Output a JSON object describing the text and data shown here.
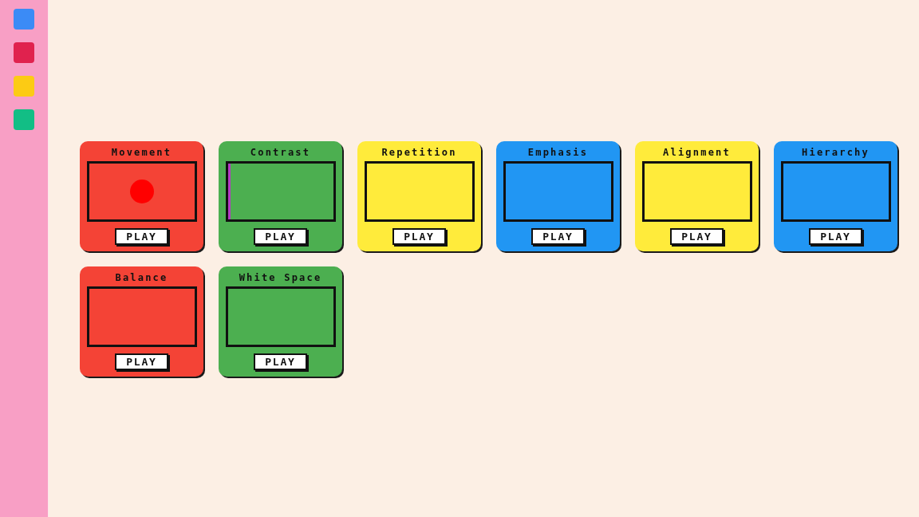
{
  "sidebar": {
    "swatches": [
      {
        "color": "#3b8bf6"
      },
      {
        "color": "#e0224e"
      },
      {
        "color": "#fccb14"
      },
      {
        "color": "#12be85"
      }
    ]
  },
  "cards": [
    {
      "title": "Movement",
      "color": "#f44336",
      "kind": "circle",
      "button": "PLAY"
    },
    {
      "title": "Contrast",
      "color": "#4caf50",
      "kind": "stripe",
      "button": "PLAY"
    },
    {
      "title": "Repetition",
      "color": "#ffeb3b",
      "kind": "blank",
      "button": "PLAY"
    },
    {
      "title": "Emphasis",
      "color": "#2196f3",
      "kind": "blank",
      "button": "PLAY"
    },
    {
      "title": "Alignment",
      "color": "#ffeb3b",
      "kind": "blank",
      "button": "PLAY"
    },
    {
      "title": "Hierarchy",
      "color": "#2196f3",
      "kind": "blank",
      "button": "PLAY"
    },
    {
      "title": "Balance",
      "color": "#f44336",
      "kind": "blank",
      "button": "PLAY"
    },
    {
      "title": "White Space",
      "color": "#4caf50",
      "kind": "blank",
      "button": "PLAY"
    }
  ]
}
